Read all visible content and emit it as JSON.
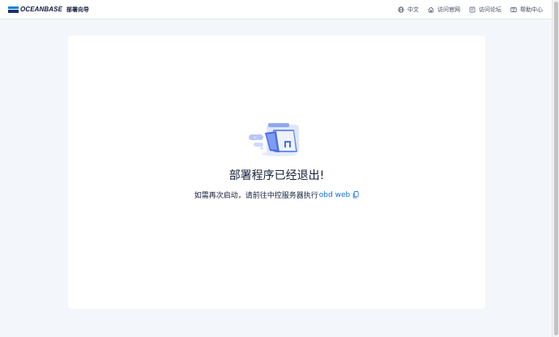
{
  "header": {
    "brand": "OCEANBASE",
    "subtitle": "部署向导",
    "nav": [
      {
        "label": "中文",
        "icon": "globe-icon"
      },
      {
        "label": "访问官网",
        "icon": "home-icon"
      },
      {
        "label": "访问论坛",
        "icon": "forum-icon"
      },
      {
        "label": "帮助中心",
        "icon": "help-book-icon"
      }
    ]
  },
  "main": {
    "title": "部署程序已经退出!",
    "description": "如需再次启动，请前往中控服务器执行",
    "command": "obd web"
  },
  "colors": {
    "accent": "#0d6ddd",
    "background": "#f3f6fb",
    "text": "#132039"
  }
}
